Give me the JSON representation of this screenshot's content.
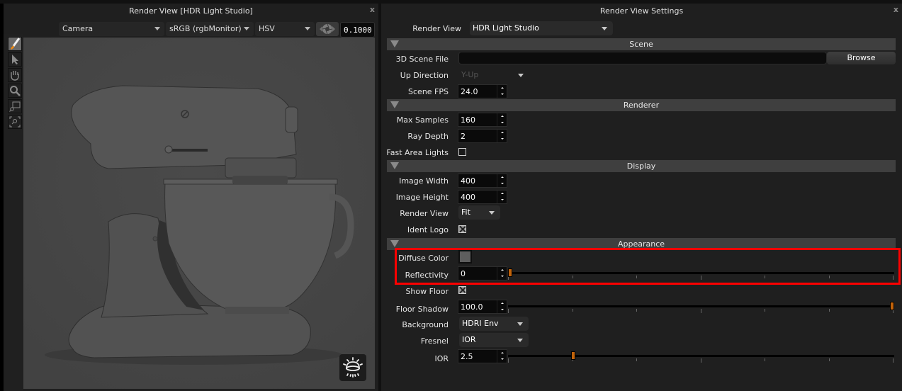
{
  "left_panel": {
    "title": "Render View [HDR Light Studio]",
    "close_label": "x",
    "camera_select": "Camera",
    "colorspace_select": "sRGB (rgbMonitor)",
    "color_mode_select": "HSV",
    "exposure_value": "0.1000",
    "tools": [
      {
        "name": "paint-brush-tool",
        "active": true
      },
      {
        "name": "select-arrow-tool",
        "active": false
      },
      {
        "name": "pan-hand-tool",
        "active": false
      },
      {
        "name": "zoom-tool",
        "active": false
      },
      {
        "name": "zoom-region-tool",
        "active": false
      },
      {
        "name": "zoom-fit-tool",
        "active": false
      }
    ],
    "viewport_content": "kitchen stand mixer render",
    "environment_button_icon": "hdri-environment-icon"
  },
  "right_panel": {
    "title": "Render View Settings",
    "close_label": "x",
    "render_view": {
      "label": "Render View",
      "value": "HDR Light Studio"
    },
    "sections": {
      "scene": "Scene",
      "renderer": "Renderer",
      "display": "Display",
      "appearance": "Appearance"
    },
    "scene": {
      "scene_file_label": "3D Scene File",
      "scene_file_value": "",
      "browse_label": "Browse",
      "up_direction_label": "Up Direction",
      "up_direction_value": "Y-Up",
      "scene_fps_label": "Scene FPS",
      "scene_fps_value": "24.0"
    },
    "renderer": {
      "max_samples_label": "Max Samples",
      "max_samples_value": "160",
      "ray_depth_label": "Ray Depth",
      "ray_depth_value": "2",
      "fast_area_lights_label": "Fast Area Lights",
      "fast_area_lights_checked": false
    },
    "display": {
      "image_width_label": "Image Width",
      "image_width_value": "400",
      "image_height_label": "Image Height",
      "image_height_value": "400",
      "render_view_label": "Render View",
      "render_view_value": "Fit",
      "ident_logo_label": "Ident Logo",
      "ident_logo_checked": true
    },
    "appearance": {
      "diffuse_color_label": "Diffuse Color",
      "diffuse_color": "#5e5e5e",
      "reflectivity_label": "Reflectivity",
      "reflectivity_value": "0",
      "reflectivity_slider_fraction": 0.0,
      "show_floor_label": "Show Floor",
      "show_floor_checked": true,
      "floor_shadow_label": "Floor Shadow",
      "floor_shadow_value": "100.0",
      "floor_shadow_slider_fraction": 1.0,
      "background_label": "Background",
      "background_value": "HDRI Env",
      "fresnel_label": "Fresnel",
      "fresnel_value": "IOR",
      "ior_label": "IOR",
      "ior_value": "2.5",
      "ior_slider_fraction": 0.166
    }
  },
  "colors": {
    "accent_handle": "#c2630a",
    "highlight_box": "#ff0000",
    "panel_bg": "#1f1f1f",
    "section_bar": "#3f3f3f"
  }
}
